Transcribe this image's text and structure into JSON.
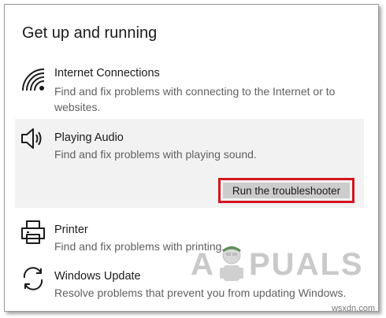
{
  "heading": "Get up and running",
  "items": [
    {
      "title": "Internet Connections",
      "description": "Find and fix problems with connecting to the Internet or to websites.",
      "icon": "wifi-icon"
    },
    {
      "title": "Playing Audio",
      "description": "Find and fix problems with playing sound.",
      "icon": "speaker-icon",
      "button_label": "Run the troubleshooter"
    },
    {
      "title": "Printer",
      "description": "Find and fix problems with printing.",
      "icon": "printer-icon"
    },
    {
      "title": "Windows Update",
      "description": "Resolve problems that prevent you from updating Windows.",
      "icon": "sync-icon"
    }
  ],
  "watermark": {
    "left": "A",
    "right": "PUALS"
  },
  "site_label": "wsxdn.com",
  "colors": {
    "highlight_border": "#d4161f",
    "selected_background": "#f2f2f2",
    "button_background": "#cccccc"
  }
}
